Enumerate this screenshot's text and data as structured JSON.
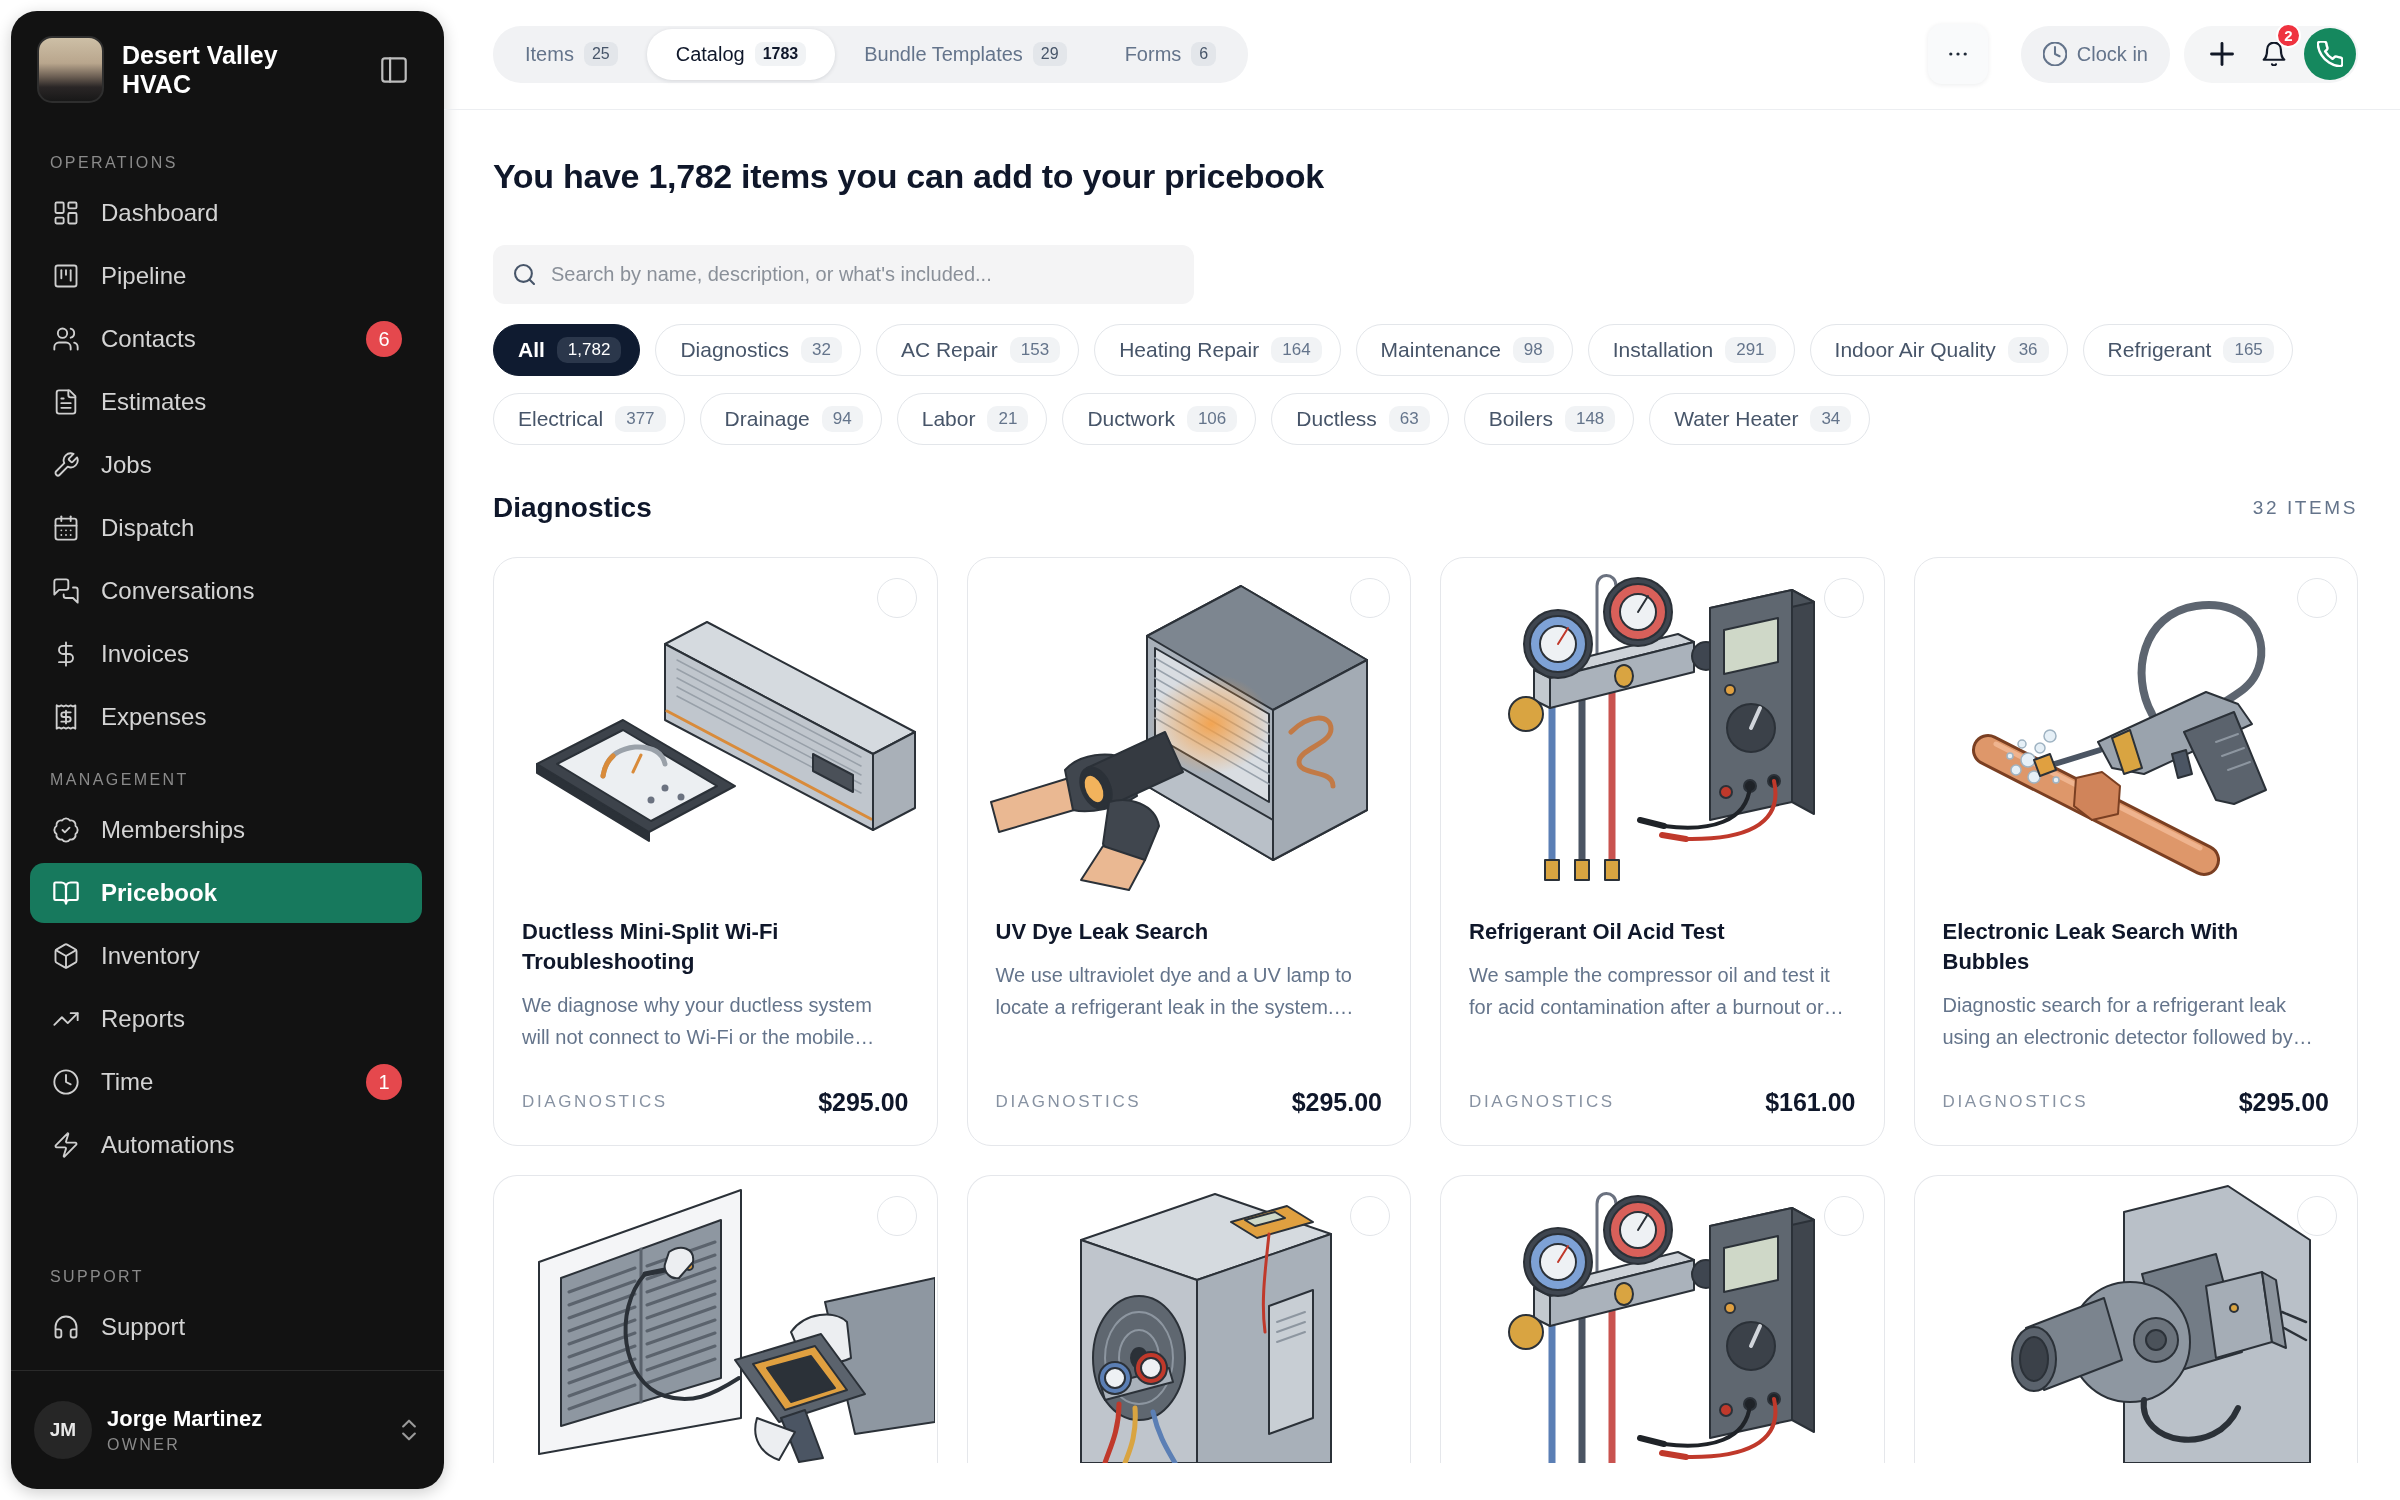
{
  "sidebar": {
    "brand": {
      "name": "Desert Valley HVAC"
    },
    "sections": [
      {
        "title": "OPERATIONS",
        "items": [
          {
            "label": "Dashboard",
            "selected": false
          },
          {
            "label": "Pipeline",
            "selected": false
          },
          {
            "label": "Contacts",
            "badge": "6",
            "selected": false
          },
          {
            "label": "Estimates",
            "selected": false
          },
          {
            "label": "Jobs",
            "selected": false
          },
          {
            "label": "Dispatch",
            "selected": false
          },
          {
            "label": "Conversations",
            "selected": false
          },
          {
            "label": "Invoices",
            "selected": false
          },
          {
            "label": "Expenses",
            "selected": false
          }
        ]
      },
      {
        "title": "MANAGEMENT",
        "items": [
          {
            "label": "Memberships",
            "selected": false
          },
          {
            "label": "Pricebook",
            "selected": true
          },
          {
            "label": "Inventory",
            "selected": false
          },
          {
            "label": "Reports",
            "selected": false
          },
          {
            "label": "Time",
            "badge": "1",
            "selected": false
          },
          {
            "label": "Automations",
            "selected": false
          }
        ]
      },
      {
        "title": "SUPPORT",
        "items": [
          {
            "label": "Support",
            "selected": false
          }
        ]
      }
    ],
    "user": {
      "initials": "JM",
      "name": "Jorge Martinez",
      "role": "OWNER"
    }
  },
  "top_bar": {
    "tabs": [
      {
        "label": "Items",
        "count": "25",
        "selected": false
      },
      {
        "label": "Catalog",
        "count": "1783",
        "selected": true
      },
      {
        "label": "Bundle Templates",
        "count": "29",
        "selected": false
      },
      {
        "label": "Forms",
        "count": "6",
        "selected": false
      }
    ],
    "clock_button": {
      "label": "Clock in"
    },
    "notifications": {
      "badge": "2"
    }
  },
  "page": {
    "heading": "You have 1,782 items you can add to your pricebook",
    "search": {
      "placeholder": "Search by name, description, or what's included..."
    },
    "filters": [
      {
        "label": "All",
        "count": "1,782",
        "selected": true
      },
      {
        "label": "Diagnostics",
        "count": "32",
        "selected": false
      },
      {
        "label": "AC Repair",
        "count": "153",
        "selected": false
      },
      {
        "label": "Heating Repair",
        "count": "164",
        "selected": false
      },
      {
        "label": "Maintenance",
        "count": "98",
        "selected": false
      },
      {
        "label": "Installation",
        "count": "291",
        "selected": false
      },
      {
        "label": "Indoor Air Quality",
        "count": "36",
        "selected": false
      },
      {
        "label": "Refrigerant",
        "count": "165",
        "selected": false
      },
      {
        "label": "Electrical",
        "count": "377",
        "selected": false
      },
      {
        "label": "Drainage",
        "count": "94",
        "selected": false
      },
      {
        "label": "Labor",
        "count": "21",
        "selected": false
      },
      {
        "label": "Ductwork",
        "count": "106",
        "selected": false
      },
      {
        "label": "Ductless",
        "count": "63",
        "selected": false
      },
      {
        "label": "Boilers",
        "count": "148",
        "selected": false
      },
      {
        "label": "Water Heater",
        "count": "34",
        "selected": false
      }
    ],
    "section": {
      "title": "Diagnostics",
      "count": "32 ITEMS",
      "cards": [
        {
          "title": "Ductless Mini-Split Wi-Fi Troubleshooting",
          "description": "We diagnose why your ductless system will not connect to Wi-Fi or the mobile…",
          "category": "DIAGNOSTICS",
          "price": "$295.00",
          "selected": false
        },
        {
          "title": "UV Dye Leak Search",
          "description": "We use ultraviolet dye and a UV lamp to locate a refrigerant leak in the system.…",
          "category": "DIAGNOSTICS",
          "price": "$295.00",
          "selected": false
        },
        {
          "title": "Refrigerant Oil Acid Test",
          "description": "We sample the compressor oil and test it for acid contamination after a burnout or…",
          "category": "DIAGNOSTICS",
          "price": "$161.00",
          "selected": false
        },
        {
          "title": "Electronic Leak Search With Bubbles",
          "description": "Diagnostic search for a refrigerant leak using an electronic detector followed by…",
          "category": "DIAGNOSTICS",
          "price": "$295.00",
          "selected": false
        },
        {
          "selected": false
        },
        {
          "selected": false
        },
        {
          "selected": false
        },
        {
          "selected": false
        }
      ]
    }
  }
}
